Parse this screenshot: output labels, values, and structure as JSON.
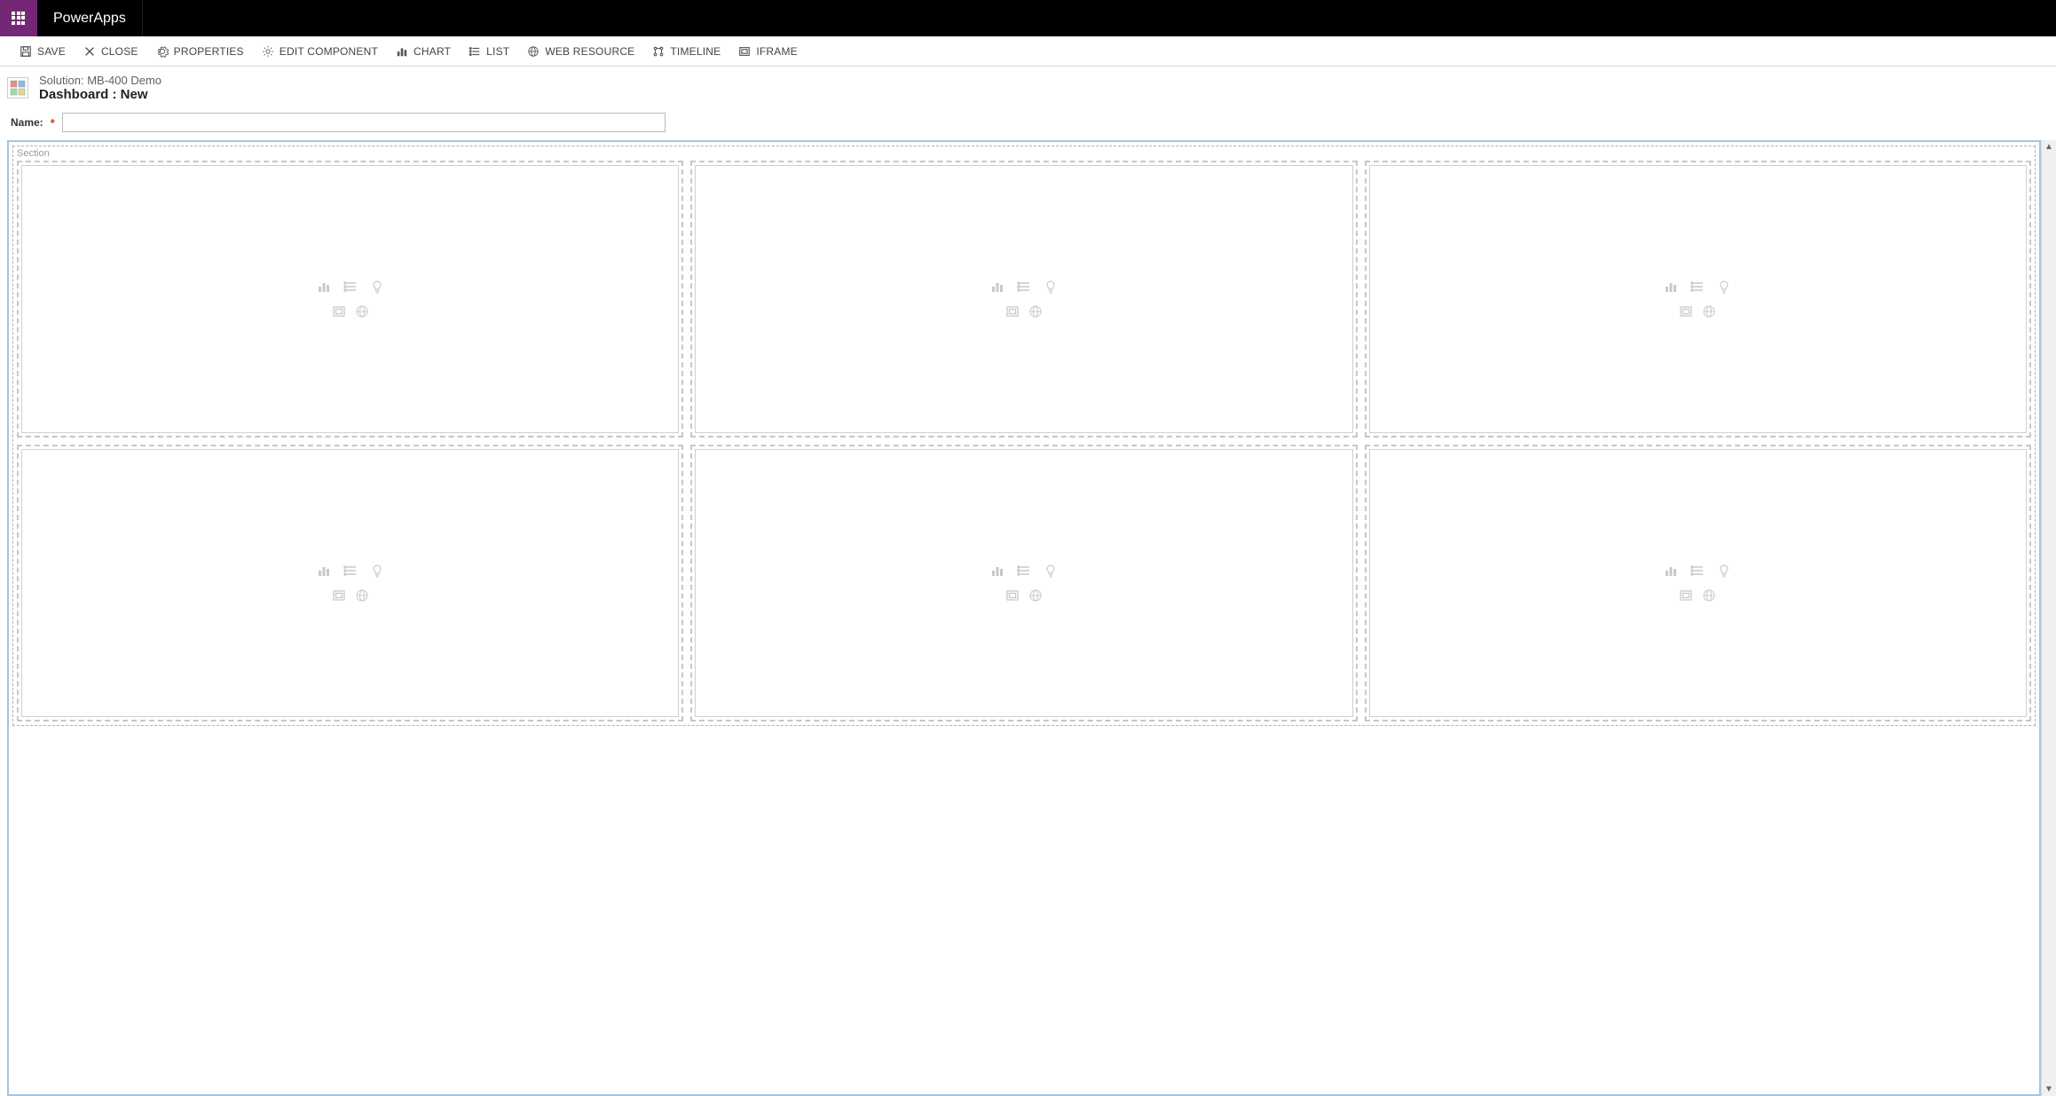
{
  "topbar": {
    "app_name": "PowerApps"
  },
  "commands": {
    "save": "SAVE",
    "close": "CLOSE",
    "properties": "PROPERTIES",
    "edit_component": "EDIT COMPONENT",
    "chart": "CHART",
    "list": "LIST",
    "web_resource": "WEB RESOURCE",
    "timeline": "TIMELINE",
    "iframe": "IFRAME"
  },
  "header": {
    "solution_line": "Solution: MB-400 Demo",
    "page_title": "Dashboard : New"
  },
  "form": {
    "name_label": "Name:",
    "name_value": ""
  },
  "section": {
    "label": "Section"
  },
  "colors": {
    "accent": "#742774"
  }
}
